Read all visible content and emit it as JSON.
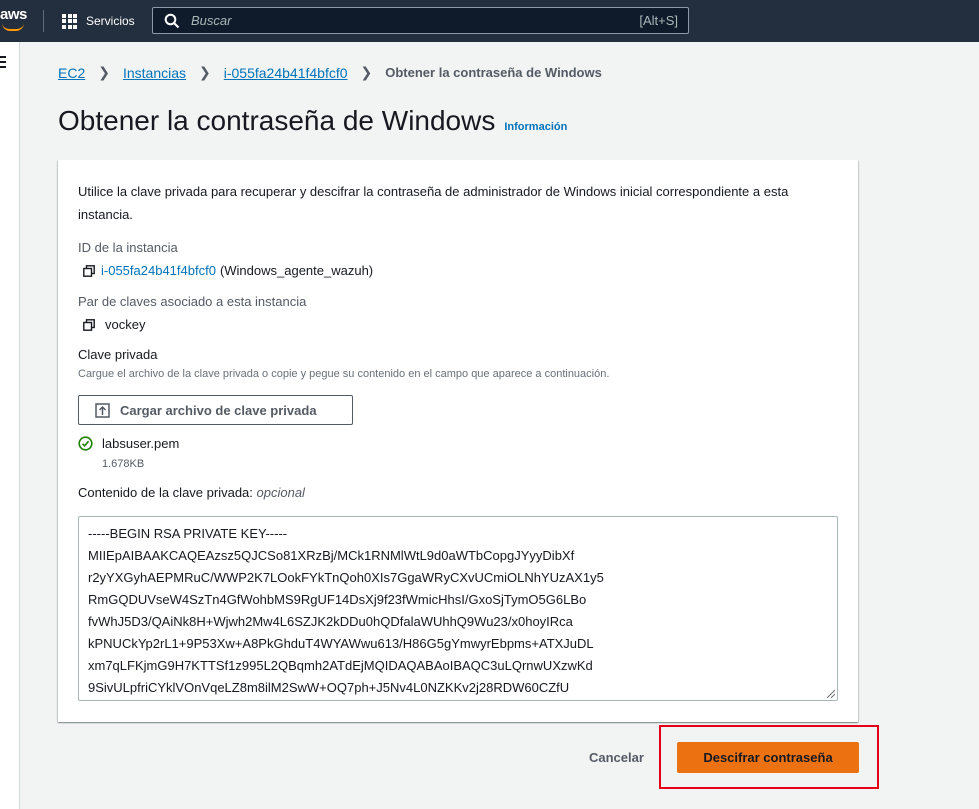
{
  "topbar": {
    "logo": "aws",
    "services_label": "Servicios",
    "search_placeholder": "Buscar",
    "search_shortcut": "[Alt+S]"
  },
  "breadcrumb": {
    "items": [
      "EC2",
      "Instancias",
      "i-055fa24b41f4bfcf0"
    ],
    "current": "Obtener la contraseña de Windows"
  },
  "page": {
    "title": "Obtener la contraseña de Windows",
    "info_link": "Información"
  },
  "card": {
    "intro": "Utilice la clave privada para recuperar y descifrar la contraseña de administrador de Windows inicial correspondiente a esta instancia.",
    "instance_id_label": "ID de la instancia",
    "instance_id": "i-055fa24b41f4bfcf0",
    "instance_name": "(Windows_agente_wazuh)",
    "keypair_label": "Par de claves asociado a esta instancia",
    "keypair_value": "vockey",
    "private_key_label": "Clave privada",
    "private_key_desc": "Cargue el archivo de la clave privada o copie y pegue su contenido en el campo que aparece a continuación.",
    "upload_button": "Cargar archivo de clave privada",
    "file_name": "labsuser.pem",
    "file_size": "1.678KB",
    "content_label": "Contenido de la clave privada:",
    "content_optional": "opcional",
    "key_lines": [
      "-----BEGIN RSA PRIVATE KEY-----",
      "MIIEpAIBAAKCAQEAzsz5QJCSo81XRzBj/MCk1RNMlWtL9d0aWTbCopgJYyyDibXf",
      "r2yYXGyhAEPMRuC/WWP2K7LOokFYkTnQoh0XIs7GgaWRyCXvUCmiOLNhYUzAX1y5",
      "RmGQDUVseW4SzTn4GfWohbMS9RgUF14DsXj9f23fWmicHhsI/GxoSjTymO5G6LBo",
      "fvWhJ5D3/QAiNk8H+Wjwh2Mw4L6SZJK2kDDu0hQDfalaWUhhQ9Wu23/x0hoyIRca",
      "kPNUCkYp2rL1+9P53Xw+A8PkGhduT4WYAWwu613/H86G5gYmwyrEbpms+ATXJuDL",
      "xm7qLFKjmG9H7KTTSf1z995L2QBqmh2ATdEjMQIDAQABAoIBAQC3uLQrnwUXzwKd",
      "9SivULpfriCYklVOnVqeLZ8m8ilM2SwW+OQ7ph+J5Nv4L0NZKKv2j28RDW60CZfU"
    ]
  },
  "footer": {
    "cancel": "Cancelar",
    "decrypt": "Descifrar contraseña"
  },
  "colors": {
    "topbar": "#232f3e",
    "link": "#0073bb",
    "primary_button": "#ec7211",
    "highlight": "#e5001a"
  }
}
